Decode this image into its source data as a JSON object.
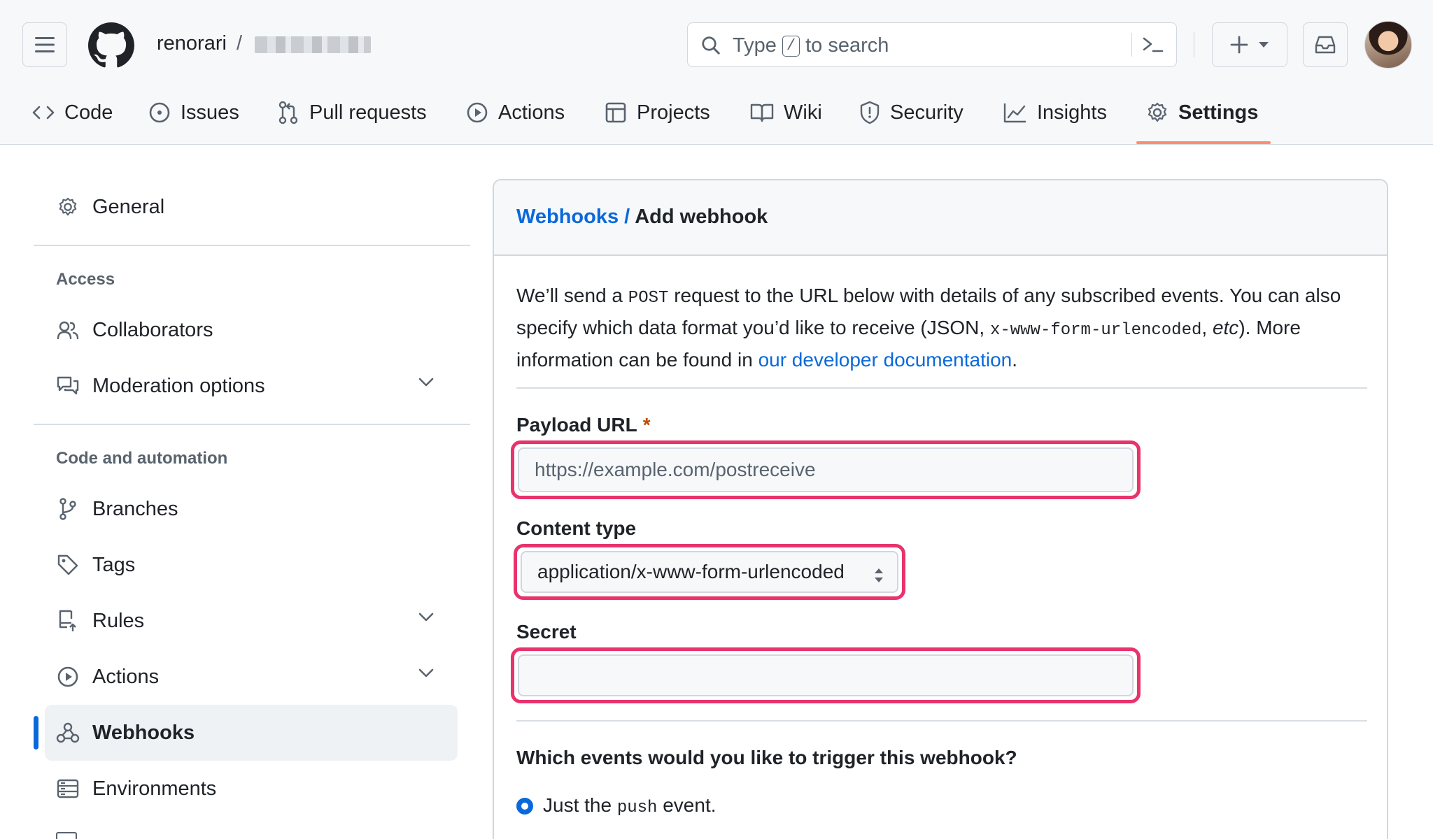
{
  "header": {
    "owner": "renorari",
    "separator": "/",
    "search": {
      "prefix": "Type",
      "key": "/",
      "suffix": "to search"
    }
  },
  "tabs": [
    {
      "label": "Code",
      "icon": "code-icon"
    },
    {
      "label": "Issues",
      "icon": "issue-opened-icon"
    },
    {
      "label": "Pull requests",
      "icon": "git-pull-request-icon"
    },
    {
      "label": "Actions",
      "icon": "play-icon"
    },
    {
      "label": "Projects",
      "icon": "table-icon"
    },
    {
      "label": "Wiki",
      "icon": "book-icon"
    },
    {
      "label": "Security",
      "icon": "shield-icon"
    },
    {
      "label": "Insights",
      "icon": "graph-icon"
    },
    {
      "label": "Settings",
      "icon": "gear-icon",
      "active": true
    }
  ],
  "sidebar": {
    "general": "General",
    "access_heading": "Access",
    "collaborators": "Collaborators",
    "moderation": "Moderation options",
    "code_heading": "Code and automation",
    "branches": "Branches",
    "tags": "Tags",
    "rules": "Rules",
    "actions": "Actions",
    "webhooks": "Webhooks",
    "environments": "Environments"
  },
  "main": {
    "breadcrumb_link": "Webhooks",
    "breadcrumb_sep": "/",
    "title": "Add webhook",
    "intro": {
      "p1": "We’ll send a",
      "post": "POST",
      "p2": "request to the URL below with details of any subscribed events. You can also specify which data format you’d like to receive (JSON,",
      "urlenc": "x-www-form-urlencoded",
      "p3": ",",
      "etc": "etc",
      "p4": "). More information can be found in",
      "doc_link": "our developer documentation",
      "p5": "."
    },
    "payload_label": "Payload URL",
    "required_mark": "*",
    "payload_placeholder": "https://example.com/postreceive",
    "content_label": "Content type",
    "content_value": "application/x-www-form-urlencoded",
    "secret_label": "Secret",
    "secret_value": "",
    "events_question": "Which events would you like to trigger this webhook?",
    "radio_p1": "Just the",
    "radio_code": "push",
    "radio_p2": "event."
  },
  "colors": {
    "accent": "#0969da",
    "highlight": "#e8336d",
    "tab_underline": "#fd8c73"
  }
}
